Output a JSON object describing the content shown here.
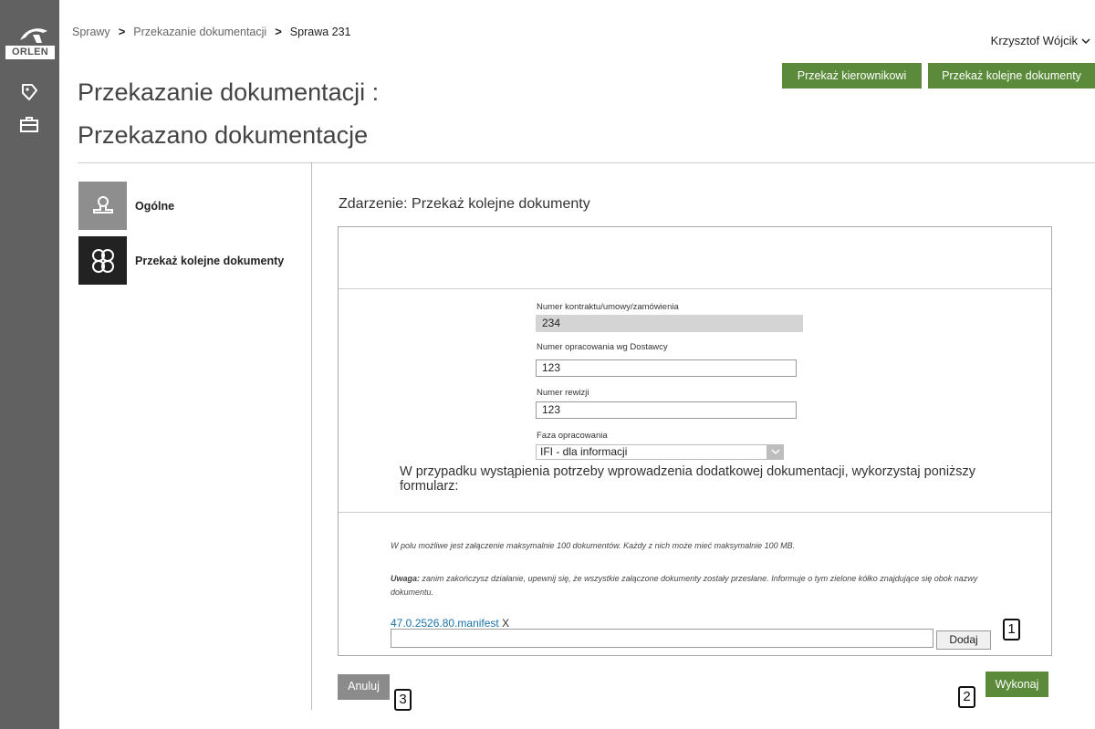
{
  "brand": {
    "logo_text": "ORLEN"
  },
  "sidebar": {
    "items": [
      {
        "icon": "document-tag-icon"
      },
      {
        "icon": "briefcase-icon"
      }
    ]
  },
  "breadcrumb": {
    "items": [
      "Sprawy",
      "Przekazanie dokumentacji",
      "Sprawa 231"
    ],
    "separator": ">"
  },
  "user": {
    "name": "Krzysztof Wójcik"
  },
  "header_actions": {
    "forward_to_manager": "Przekaż kierownikowi",
    "forward_more_docs": "Przekaż kolejne dokumenty"
  },
  "page": {
    "title": "Przekazanie dokumentacji :",
    "subtitle": "Przekazano dokumentacje"
  },
  "left_nav": {
    "items": [
      {
        "label": "Ogólne",
        "icon": "stamp-icon"
      },
      {
        "label": "Przekaż kolejne dokumenty",
        "icon": "hexagon-pattern-icon"
      }
    ]
  },
  "event": {
    "title": "Zdarzenie: Przekaż kolejne dokumenty"
  },
  "form": {
    "contract": {
      "label": "Numer kontraktu/umowy/zamówienia",
      "value": "234"
    },
    "supplier_no": {
      "label": "Numer opracowania wg Dostawcy",
      "value": "123"
    },
    "revision": {
      "label": "Numer rewizji",
      "value": "123"
    },
    "phase": {
      "label": "Faza opracowania",
      "value": "IFI - dla informacji"
    },
    "notice": "W przypadku wystąpienia potrzeby wprowadzenia dodatkowej dokumentacji, wykorzystaj poniższy formularz:"
  },
  "attachments": {
    "limit_info": "W polu możliwe jest załączenie maksymalnie 100 dokumentów. Każdy z nich może mieć maksymalnie 100 MB.",
    "warning_label": "Uwaga:",
    "warning_text": " zanim zakończysz działanie, upewnij się, że wszystkie załączone dokumenty zostały przesłane. Informuje o tym zielone kółko znajdujące się obok nazwy dokumentu.",
    "file_name": "47.0.2526.80.manifest",
    "remove_label": "X",
    "add_label": "Dodaj"
  },
  "footer": {
    "cancel_label": "Anuluj",
    "submit_label": "Wykonaj"
  },
  "markers": [
    "1",
    "2",
    "3"
  ],
  "colors": {
    "sidebar": "#616161",
    "accent_green": "#5a8a3a",
    "cancel_gray": "#8b8b8b",
    "link": "#1a73a8"
  }
}
